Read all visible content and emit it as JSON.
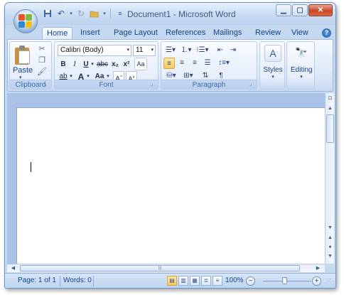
{
  "window": {
    "title_doc": "Document1",
    "title_sep": " - ",
    "title_app": "Microsoft Word"
  },
  "tabs": [
    {
      "label": "Home",
      "active": true
    },
    {
      "label": "Insert"
    },
    {
      "label": "Page Layout"
    },
    {
      "label": "References"
    },
    {
      "label": "Mailings"
    },
    {
      "label": "Review"
    },
    {
      "label": "View"
    }
  ],
  "groups": {
    "clipboard": {
      "label": "Clipboard",
      "paste_label": "Paste"
    },
    "font": {
      "label": "Font",
      "font_name": "Calibri (Body)",
      "font_size": "11",
      "bold": "B",
      "italic": "I",
      "underline": "U",
      "strike": "abc",
      "subscript": "x₂",
      "superscript": "x²",
      "clear_format": "Aa",
      "grow": "A",
      "shrink": "A",
      "change_case": "Aa",
      "highlight": "ab",
      "font_color": "A"
    },
    "paragraph": {
      "label": "Paragraph"
    },
    "styles": {
      "label": "Styles"
    },
    "editing": {
      "label": "Editing"
    }
  },
  "status": {
    "page": "Page: 1 of 1",
    "words": "Words: 0",
    "zoom": "100%"
  },
  "colors": {
    "accent": "#15428b",
    "highlight_active": "#f7c75a"
  }
}
